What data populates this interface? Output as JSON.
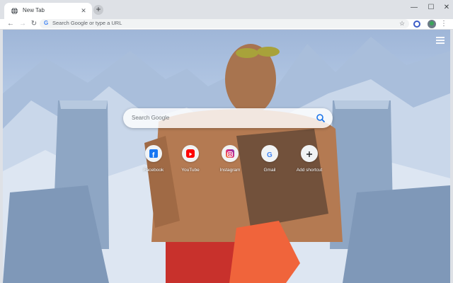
{
  "tab": {
    "title": "New Tab",
    "favicon": "globe-icon"
  },
  "toolbar": {
    "omnibox_placeholder": "Search Google or type a URL"
  },
  "ntp": {
    "search_placeholder": "Search Google",
    "shortcuts": [
      {
        "label": "Facebook",
        "icon": "facebook-icon",
        "color": "#1877f2"
      },
      {
        "label": "YouTube",
        "icon": "youtube-icon",
        "color": "#ff0000"
      },
      {
        "label": "Instagram",
        "icon": "instagram-icon",
        "color": "#c13584"
      },
      {
        "label": "Gmail",
        "icon": "google-icon",
        "color": "#4285f4"
      },
      {
        "label": "Add shortcut",
        "icon": "plus-icon",
        "color": "#202124"
      }
    ]
  },
  "colors": {
    "tabstrip": "#dee1e6",
    "toolbar": "#ffffff",
    "omnibox": "#f1f3f4"
  }
}
